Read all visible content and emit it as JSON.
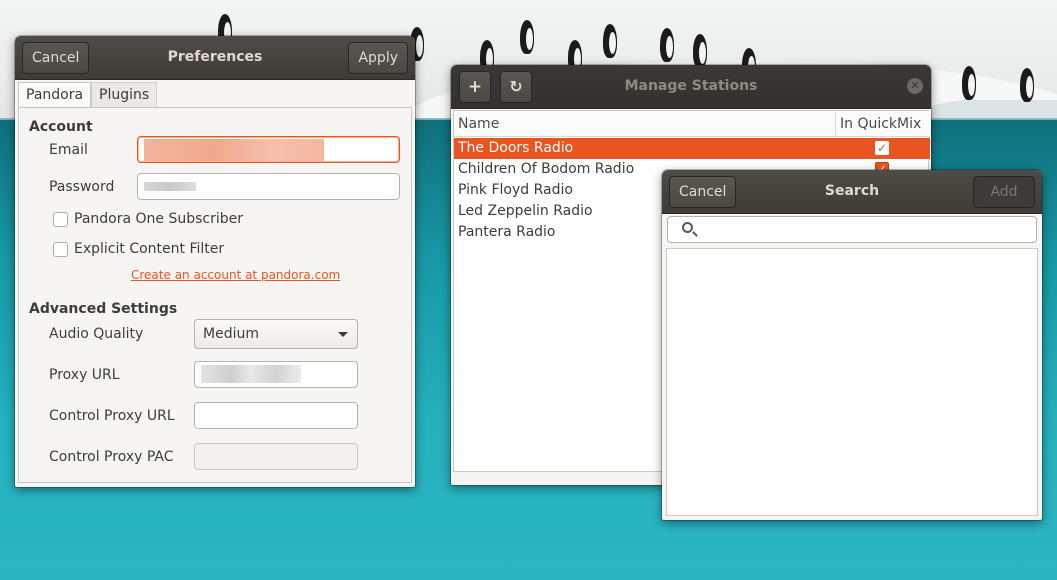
{
  "preferences": {
    "title": "Preferences",
    "cancel_label": "Cancel",
    "apply_label": "Apply",
    "tabs": [
      {
        "label": "Pandora",
        "active": true
      },
      {
        "label": "Plugins",
        "active": false
      }
    ],
    "account": {
      "heading": "Account",
      "email_label": "Email",
      "password_label": "Password",
      "pandora_one_label": "Pandora One Subscriber",
      "explicit_filter_label": "Explicit Content Filter",
      "create_account_link": "Create an account at pandora.com"
    },
    "advanced": {
      "heading": "Advanced Settings",
      "audio_quality_label": "Audio Quality",
      "audio_quality_value": "Medium",
      "proxy_url_label": "Proxy URL",
      "control_proxy_url_label": "Control Proxy URL",
      "control_proxy_pac_label": "Control Proxy PAC"
    }
  },
  "stations": {
    "title": "Manage Stations",
    "add_icon": "plus-icon",
    "refresh_icon": "refresh-icon",
    "columns": {
      "name": "Name",
      "quickmix": "In QuickMix"
    },
    "rows": [
      {
        "name": "The Doors Radio",
        "quickmix": true,
        "selected": true
      },
      {
        "name": "Children Of Bodom Radio",
        "quickmix": true,
        "selected": false
      },
      {
        "name": "Pink Floyd Radio",
        "quickmix": false,
        "selected": false
      },
      {
        "name": "Led Zeppelin Radio",
        "quickmix": false,
        "selected": false
      },
      {
        "name": "Pantera Radio",
        "quickmix": false,
        "selected": false
      }
    ]
  },
  "search": {
    "title": "Search",
    "cancel_label": "Cancel",
    "add_label": "Add"
  },
  "colors": {
    "accent": "#e95420",
    "headerbar": "#3e3b37",
    "window_bg": "#f6f5f4"
  }
}
